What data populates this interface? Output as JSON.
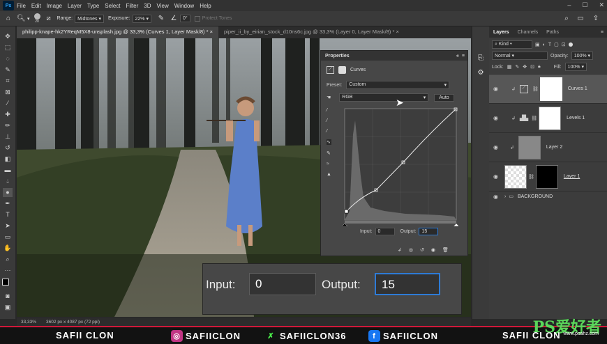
{
  "app": {
    "logo": "Ps"
  },
  "menu": [
    "File",
    "Edit",
    "Image",
    "Layer",
    "Type",
    "Select",
    "Filter",
    "3D",
    "View",
    "Window",
    "Help"
  ],
  "options": {
    "brush_size": "20",
    "range_label": "Range:",
    "range_value": "Midtones",
    "exposure_label": "Exposure:",
    "exposure_value": "22%",
    "angle_value": "0°",
    "protect_tones": "Protect Tones"
  },
  "tabs": [
    {
      "label": "philipp-knape-hk2YReqM5X8-unsplash.jpg @ 33,3% (Curves 1, Layer Mask/8) *",
      "close": "×"
    },
    {
      "label": "piper_ii_by_eirian_stock_d10ns6c.jpg @ 33,3% (Layer 0, Layer Mask/8) *",
      "close": "×"
    }
  ],
  "status": {
    "zoom": "33,33%",
    "dims": "3602 px x 4087 px (72 ppi)"
  },
  "properties": {
    "title": "Properties",
    "adj_name": "Curves",
    "preset_label": "Preset:",
    "preset_value": "Custom",
    "channel": "RGB",
    "auto": "Auto",
    "input_label": "Input:",
    "input_value": "0",
    "output_label": "Output:",
    "output_value": "15"
  },
  "zoom_box": {
    "input_label": "Input:",
    "input_value": "0",
    "output_label": "Output:",
    "output_value": "15"
  },
  "layers_panel": {
    "tabs": [
      "Layers",
      "Channels",
      "Paths"
    ],
    "kind": "Kind",
    "blend": "Normal",
    "opacity_label": "Opacity:",
    "opacity": "100%",
    "lock_label": "Lock:",
    "fill_label": "Fill:",
    "fill": "100%",
    "layers": [
      {
        "name": "Curves 1",
        "type": "curves",
        "selected": true
      },
      {
        "name": "Levels 1",
        "type": "levels",
        "selected": false
      },
      {
        "name": "Layer 2",
        "type": "pixel",
        "selected": false
      },
      {
        "name": "Layer 1",
        "type": "masked",
        "selected": false
      }
    ],
    "group": "BACKGROUND"
  },
  "banner": {
    "name": "SAFII CLON",
    "instagram": "SAFIICLON",
    "tiktok": "SAFIICLON36",
    "facebook": "SAFIICLON",
    "right_text": "SAFII CLON"
  },
  "watermark": {
    "main": "PS爱好者",
    "sub": "www.psahz.com"
  },
  "colors": {
    "accent_blue": "#31a8ff",
    "banner_red": "#d0183a",
    "selected_field": "#2e7bd6"
  }
}
